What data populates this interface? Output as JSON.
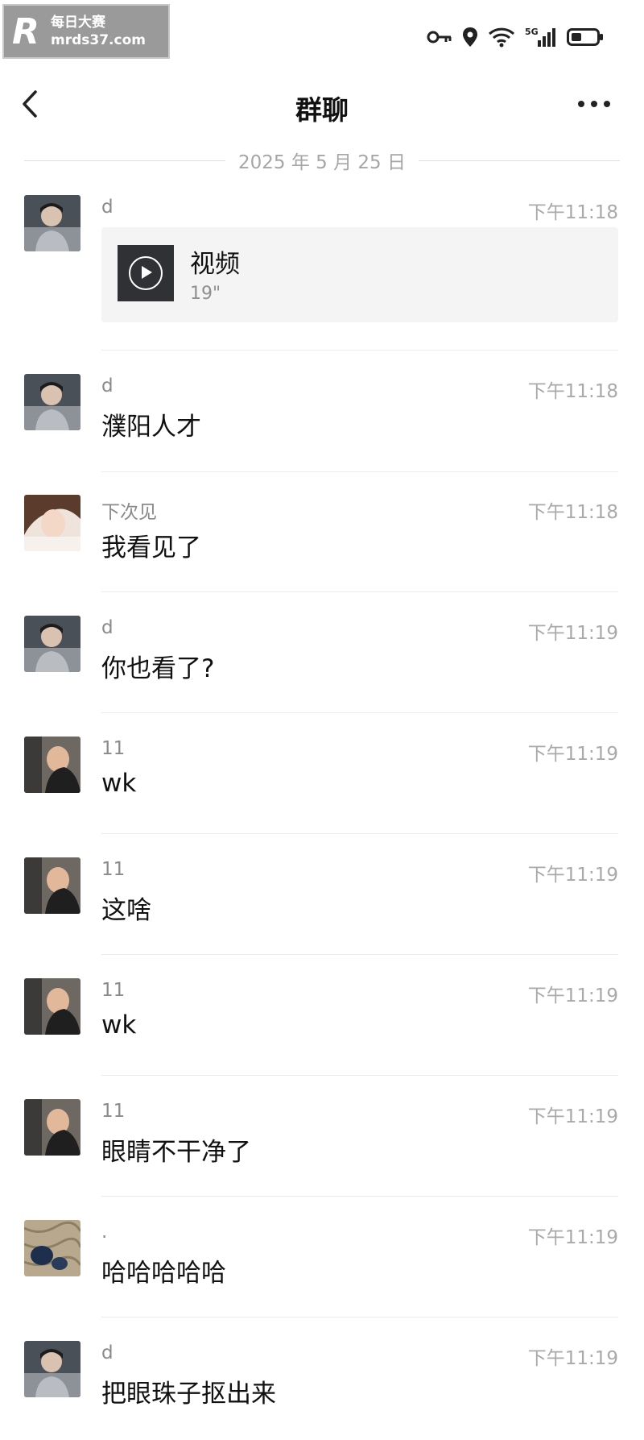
{
  "watermark": {
    "logo": "R",
    "line1": "每日大赛",
    "line2": "mrds37.com"
  },
  "header": {
    "title": "群聊"
  },
  "date_divider": "2025 年 5 月 25 日",
  "messages": [
    {
      "sender": "d",
      "time": "下午11:18",
      "type": "video",
      "video_title": "视频",
      "video_duration": "19\"",
      "avatar": "avatar-d"
    },
    {
      "sender": "d",
      "time": "下午11:18",
      "text": "濮阳人才",
      "avatar": "avatar-d"
    },
    {
      "sender": "下次见",
      "time": "下午11:18",
      "text": "我看见了",
      "avatar": "avatar-xiacijian"
    },
    {
      "sender": "d",
      "time": "下午11:19",
      "text": "你也看了?",
      "avatar": "avatar-d"
    },
    {
      "sender": "11",
      "time": "下午11:19",
      "text": "wk",
      "avatar": "avatar-11"
    },
    {
      "sender": "11",
      "time": "下午11:19",
      "text": "这啥",
      "avatar": "avatar-11"
    },
    {
      "sender": "11",
      "time": "下午11:19",
      "text": "wk",
      "avatar": "avatar-11"
    },
    {
      "sender": "11",
      "time": "下午11:19",
      "text": "眼睛不干净了",
      "avatar": "avatar-11"
    },
    {
      "sender": ".",
      "time": "下午11:19",
      "text": "哈哈哈哈哈",
      "avatar": "avatar-dot"
    },
    {
      "sender": "d",
      "time": "下午11:19",
      "text": "把眼珠子抠出来",
      "avatar": "avatar-d"
    }
  ],
  "colors": {
    "background": "#ffffff",
    "text": "#111111",
    "meta": "#a9a9a9",
    "card": "#f4f4f4"
  }
}
